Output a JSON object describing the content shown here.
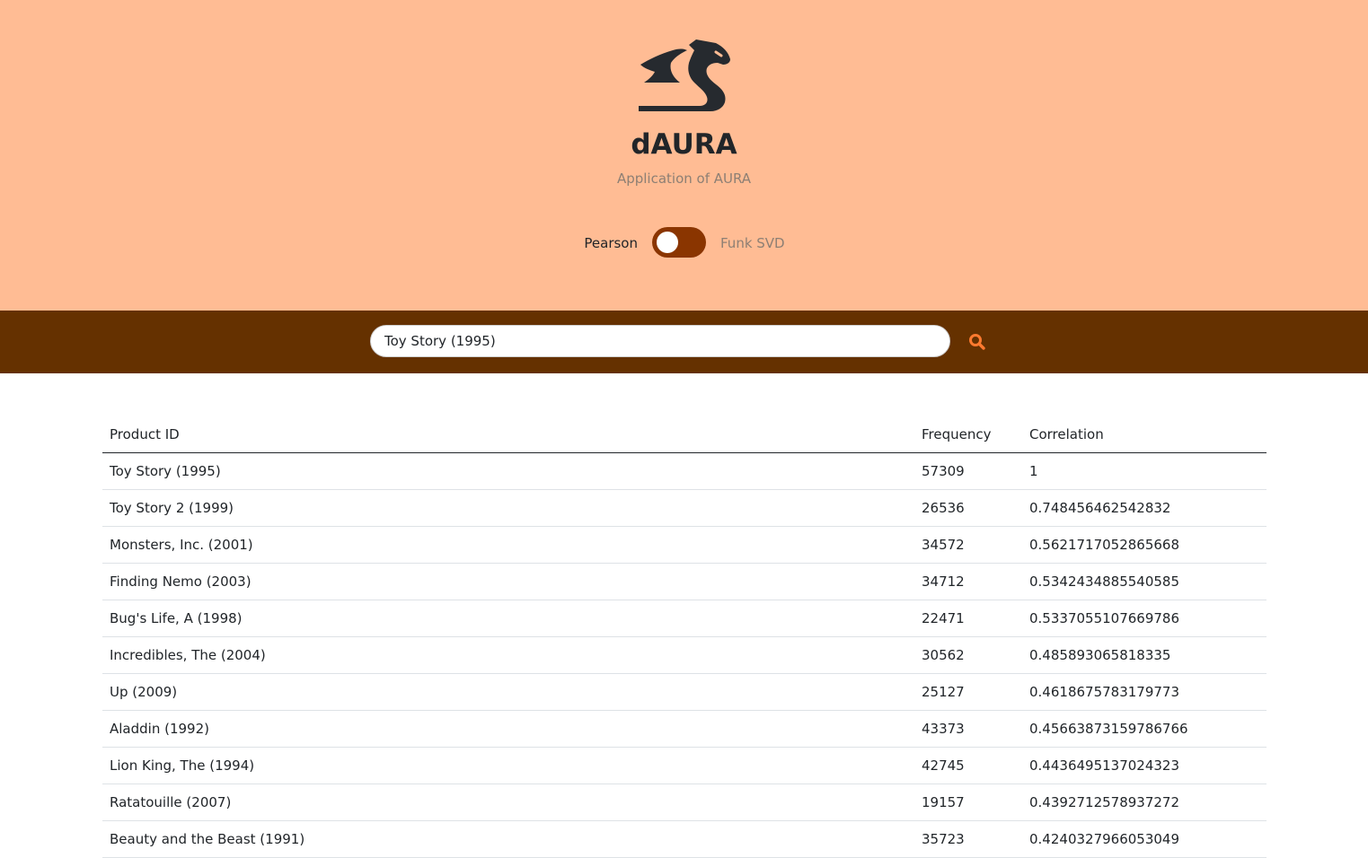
{
  "header": {
    "logo_icon": "dragon-icon",
    "title": "dAURA",
    "subtitle": "Application of AURA",
    "bg_color": "#ffbc94"
  },
  "algorithm_toggle": {
    "left_label": "Pearson",
    "right_label": "Funk SVD",
    "selected": "Pearson",
    "track_color": "#8a3500"
  },
  "search": {
    "value": "Toy Story (1995)",
    "button_icon": "search-icon",
    "bar_color": "#653100",
    "accent_color": "#ff7a2f"
  },
  "table": {
    "columns": [
      "Product ID",
      "Frequency",
      "Correlation"
    ],
    "rows": [
      [
        "Toy Story (1995)",
        "57309",
        "1"
      ],
      [
        "Toy Story 2 (1999)",
        "26536",
        "0.748456462542832"
      ],
      [
        "Monsters, Inc. (2001)",
        "34572",
        "0.5621717052865668"
      ],
      [
        "Finding Nemo (2003)",
        "34712",
        "0.5342434885540585"
      ],
      [
        "Bug's Life, A (1998)",
        "22471",
        "0.5337055107669786"
      ],
      [
        "Incredibles, The (2004)",
        "30562",
        "0.485893065818335"
      ],
      [
        "Up (2009)",
        "25127",
        "0.4618675783179773"
      ],
      [
        "Aladdin (1992)",
        "43373",
        "0.45663873159786766"
      ],
      [
        "Lion King, The (1994)",
        "42745",
        "0.4436495137024323"
      ],
      [
        "Ratatouille (2007)",
        "19157",
        "0.4392712578937272"
      ],
      [
        "Beauty and the Beast (1991)",
        "35723",
        "0.4240327966053049"
      ]
    ]
  }
}
